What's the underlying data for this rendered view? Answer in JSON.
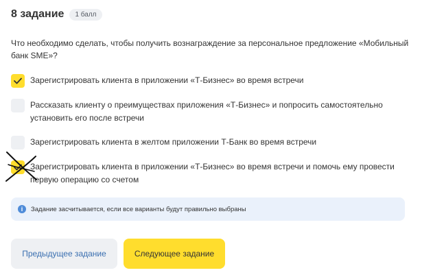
{
  "task": {
    "title": "8 задание",
    "points_badge": "1 балл"
  },
  "question": "Что необходимо сделать, чтобы получить вознаграждение за персональное предложение «Мобильный банк SME»?",
  "options": [
    {
      "label": "Зарегистрировать клиента в приложении «Т-Бизнес» во время встречи",
      "checked": true
    },
    {
      "label": "Рассказать клиенту о преимуществах приложения «Т-Бизнес» и попросить самостоятельно установить его после встречи",
      "checked": false
    },
    {
      "label": "Зарегистрировать клиента в желтом приложении Т-Банк во время встречи",
      "checked": false
    },
    {
      "label": "Зарегистрировать клиента в приложении «Т-Бизнес» во время встречи и помочь ему провести первую операцию со счетом",
      "checked": true,
      "crossed_out": true
    }
  ],
  "info": {
    "icon": "info-icon",
    "text": "Задание засчитывается, если все варианты будут правильно выбраны"
  },
  "buttons": {
    "prev_label": "Предыдущее задание",
    "next_label": "Следующее задание"
  },
  "colors": {
    "accent_yellow": "#ffdd2d",
    "checkbox_gray": "#eef0f3",
    "info_bg": "#eaf1fb",
    "info_icon": "#4f8cd9",
    "link_blue": "#3a6fb0",
    "text": "#333333"
  }
}
